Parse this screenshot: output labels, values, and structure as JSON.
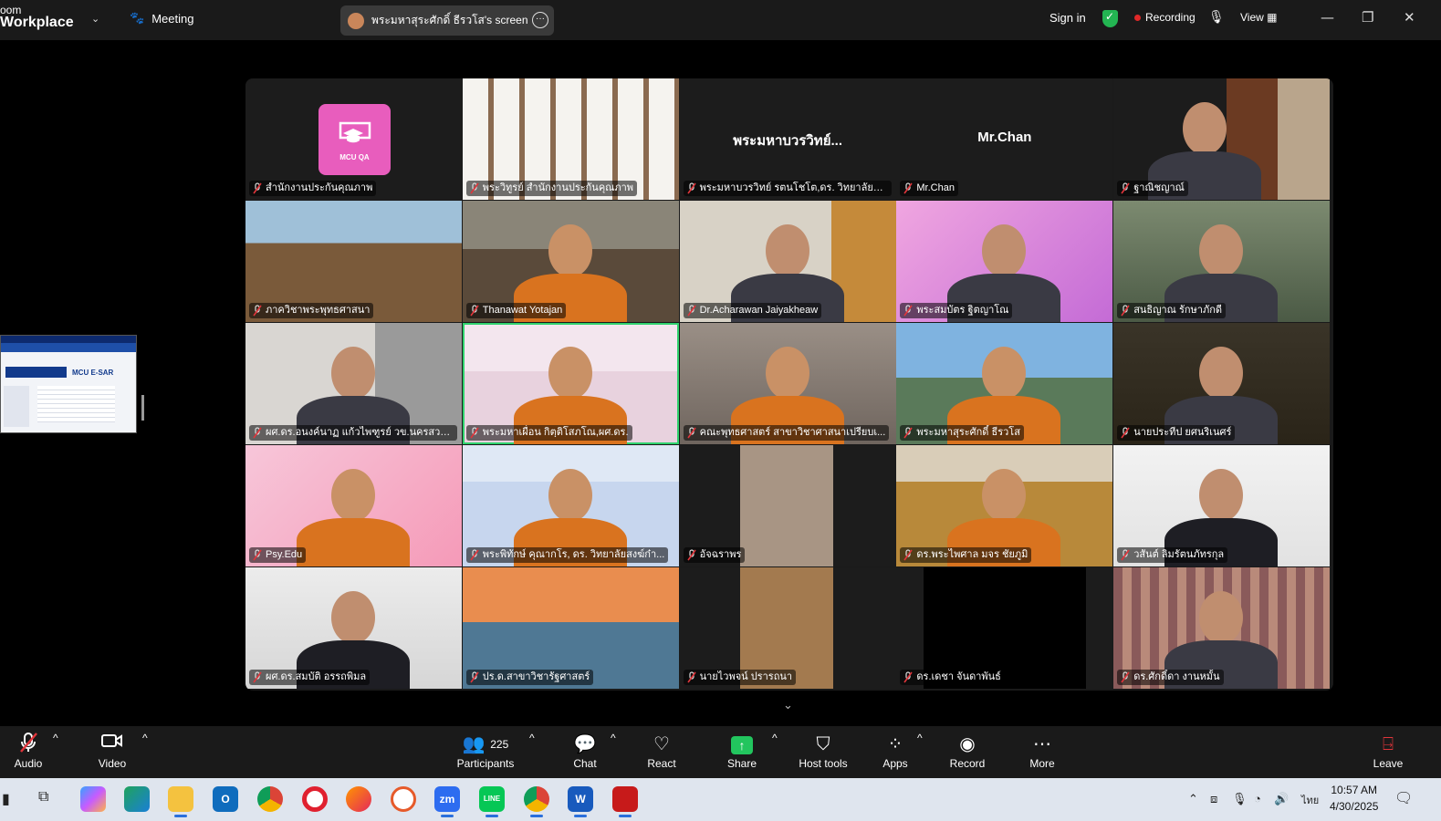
{
  "app": {
    "brand_line1": "oom",
    "brand_line2": "Workplace",
    "meeting_label": "Meeting",
    "share_pill": "พระมหาสุระศักดิ์ ธีรวโส's screen"
  },
  "topbar": {
    "sign_in": "Sign in",
    "recording": "Recording",
    "view": "View"
  },
  "shared_screen": {
    "title": "MCU E-SAR"
  },
  "participants": [
    {
      "name": "สำนักงานประกันคุณภาพ",
      "logo_text": "MCU QA"
    },
    {
      "name": "พระวิทูรย์ สำนักงานประกันคุณภาพ"
    },
    {
      "name": "พระมหาบวรวิทย์ รตนโชโต,ดร. วิทยาลัยสงฆ์...",
      "display": "พระมหาบวรวิทย์..."
    },
    {
      "name": "Mr.Chan",
      "display": "Mr.Chan"
    },
    {
      "name": "ฐาณิชญาณ์"
    },
    {
      "name": "ภาควิชาพระพุทธศาสนา"
    },
    {
      "name": "Thanawat Yotajan"
    },
    {
      "name": "Dr.Acharawan Jaiyakheaw"
    },
    {
      "name": "พระสมบัตร  ฐิตญาโณ"
    },
    {
      "name": "สนธิญาณ รักษาภักดี"
    },
    {
      "name": "ผศ.ดร.อนงค์นาฏ  แก้วไพฑูรย์ วข.นครสวร..."
    },
    {
      "name": "พระมหาเผื่อน กิตฺติโสภโณ,ผศ.ดร."
    },
    {
      "name": "คณะพุทธศาสตร์ สาขาวิชาศาสนาเปรียบเ..."
    },
    {
      "name": "พระมหาสุระศักดิ์ ธีรวโส"
    },
    {
      "name": "นายประทีป  ยศนริเนศร์"
    },
    {
      "name": "Psy.Edu"
    },
    {
      "name": "พระพิทักษ์ คุณากโร, ดร. วิทยาลัยสงฆ์ก๋า..."
    },
    {
      "name": "อัจฉราพร"
    },
    {
      "name": "ดร.พระไพศาล มจร ชัยภูมิ"
    },
    {
      "name": "วสันต์ ลิมรัตนภัทรกุล"
    },
    {
      "name": "ผศ.ดร.สมบัติ อรรถพิมล"
    },
    {
      "name": "ปร.ด.สาขาวิชารัฐศาสตร์"
    },
    {
      "name": "นายไวพจน์  ปรารถนา"
    },
    {
      "name": "ดร.เดชา จันดาพันธ์"
    },
    {
      "name": "ดร.ศักดิ์ดา งานหมั้น"
    }
  ],
  "toolbar": {
    "audio": "Audio",
    "video": "Video",
    "participants": "Participants",
    "participants_count": "225",
    "chat": "Chat",
    "react": "React",
    "share": "Share",
    "host_tools": "Host tools",
    "apps": "Apps",
    "record": "Record",
    "more": "More",
    "leave": "Leave"
  },
  "taskbar": {
    "lang": "ไทย",
    "time": "10:57 AM",
    "date": "4/30/2025",
    "apps": [
      "copilot-icon",
      "edge-icon",
      "file-explorer-icon",
      "outlook-icon",
      "chrome-icon",
      "opera-icon",
      "firefox-icon",
      "app-icon",
      "zoom-icon",
      "line-icon",
      "chrome-profile-icon",
      "word-icon",
      "acrobat-icon"
    ],
    "zoom_label": "zm",
    "line_label": "LINE",
    "outlook_label": "O",
    "word_label": "W"
  },
  "colors": {
    "active_speaker": "#2fd26d",
    "record_dot": "#e02828",
    "share_green": "#22c55e",
    "mute_red": "#e0353b",
    "qa_pink": "#e85dbd"
  }
}
